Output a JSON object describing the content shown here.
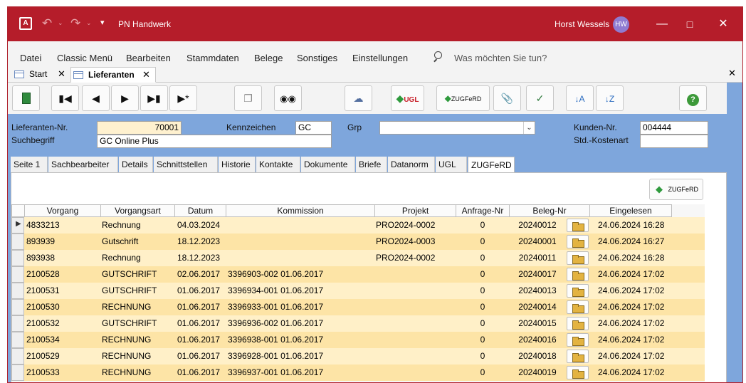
{
  "window": {
    "app_title": "PN Handwerk",
    "user_name": "Horst Wessels",
    "user_initials": "HW",
    "accent": "#b51d2a"
  },
  "menu": {
    "items": [
      "Datei",
      "Classic Menü",
      "Bearbeiten",
      "Stammdaten",
      "Belege",
      "Sonstiges",
      "Einstellungen"
    ],
    "tell_me": "Was möchten Sie tun?"
  },
  "doc_tabs": [
    {
      "label": "Start"
    },
    {
      "label": "Lieferanten"
    }
  ],
  "toolbar": {
    "ugl_label": "UGL",
    "zugferd_label": "ZUGFeRD"
  },
  "form": {
    "lieferanten_nr_label": "Lieferanten-Nr.",
    "lieferanten_nr": "70001",
    "suchbegriff_label": "Suchbegriff",
    "suchbegriff": "GC Online Plus",
    "kennzeichen_label": "Kennzeichen",
    "kennzeichen": "GC",
    "grp_label": "Grp",
    "grp": "",
    "kunden_nr_label": "Kunden-Nr.",
    "kunden_nr": "004444",
    "kostenart_label": "Std.-Kostenart",
    "kostenart": ""
  },
  "subtabs": [
    "Seite 1",
    "Sachbearbeiter",
    "Details",
    "Schnittstellen",
    "Historie",
    "Kontakte",
    "Dokumente",
    "Briefe",
    "Datanorm",
    "UGL",
    "ZUGFeRD"
  ],
  "panel": {
    "zugferd_button": "ZUGFeRD"
  },
  "table": {
    "columns": [
      "Vorgang",
      "Vorgangsart",
      "Datum",
      "Kommission",
      "Projekt",
      "Anfrage-Nr",
      "Beleg-Nr",
      "Eingelesen"
    ],
    "rows": [
      {
        "vorgang": "4833213",
        "art": "Rechnung",
        "datum": "04.03.2024",
        "kommission": "",
        "projekt": "PRO2024-0002",
        "anfrage": "0",
        "beleg": "20240012",
        "eingelesen": "24.06.2024 16:28"
      },
      {
        "vorgang": "893939",
        "art": "Gutschrift",
        "datum": "18.12.2023",
        "kommission": "",
        "projekt": "PRO2024-0003",
        "anfrage": "0",
        "beleg": "20240001",
        "eingelesen": "24.06.2024 16:27"
      },
      {
        "vorgang": "893938",
        "art": "Rechnung",
        "datum": "18.12.2023",
        "kommission": "",
        "projekt": "PRO2024-0002",
        "anfrage": "0",
        "beleg": "20240011",
        "eingelesen": "24.06.2024 16:28"
      },
      {
        "vorgang": "2100528",
        "art": "GUTSCHRIFT",
        "datum": "02.06.2017",
        "kommission": "3396903-002 01.06.2017",
        "projekt": "",
        "anfrage": "0",
        "beleg": "20240017",
        "eingelesen": "24.06.2024 17:02"
      },
      {
        "vorgang": "2100531",
        "art": "GUTSCHRIFT",
        "datum": "01.06.2017",
        "kommission": "3396934-001 01.06.2017",
        "projekt": "",
        "anfrage": "0",
        "beleg": "20240013",
        "eingelesen": "24.06.2024 17:02"
      },
      {
        "vorgang": "2100530",
        "art": "RECHNUNG",
        "datum": "01.06.2017",
        "kommission": "3396933-001 01.06.2017",
        "projekt": "",
        "anfrage": "0",
        "beleg": "20240014",
        "eingelesen": "24.06.2024 17:02"
      },
      {
        "vorgang": "2100532",
        "art": "GUTSCHRIFT",
        "datum": "01.06.2017",
        "kommission": "3396936-002 01.06.2017",
        "projekt": "",
        "anfrage": "0",
        "beleg": "20240015",
        "eingelesen": "24.06.2024 17:02"
      },
      {
        "vorgang": "2100534",
        "art": "RECHNUNG",
        "datum": "01.06.2017",
        "kommission": "3396938-001 01.06.2017",
        "projekt": "",
        "anfrage": "0",
        "beleg": "20240016",
        "eingelesen": "24.06.2024 17:02"
      },
      {
        "vorgang": "2100529",
        "art": "RECHNUNG",
        "datum": "01.06.2017",
        "kommission": "3396928-001 01.06.2017",
        "projekt": "",
        "anfrage": "0",
        "beleg": "20240018",
        "eingelesen": "24.06.2024 17:02"
      },
      {
        "vorgang": "2100533",
        "art": "RECHNUNG",
        "datum": "01.06.2017",
        "kommission": "3396937-001 01.06.2017",
        "projekt": "",
        "anfrage": "0",
        "beleg": "20240019",
        "eingelesen": "24.06.2024 17:02"
      }
    ]
  },
  "colors": {
    "row_even": "#fff0c8",
    "row_odd": "#fde4a6",
    "form_background": "#7ea6dc",
    "highlight_field": "#fff1cf"
  }
}
